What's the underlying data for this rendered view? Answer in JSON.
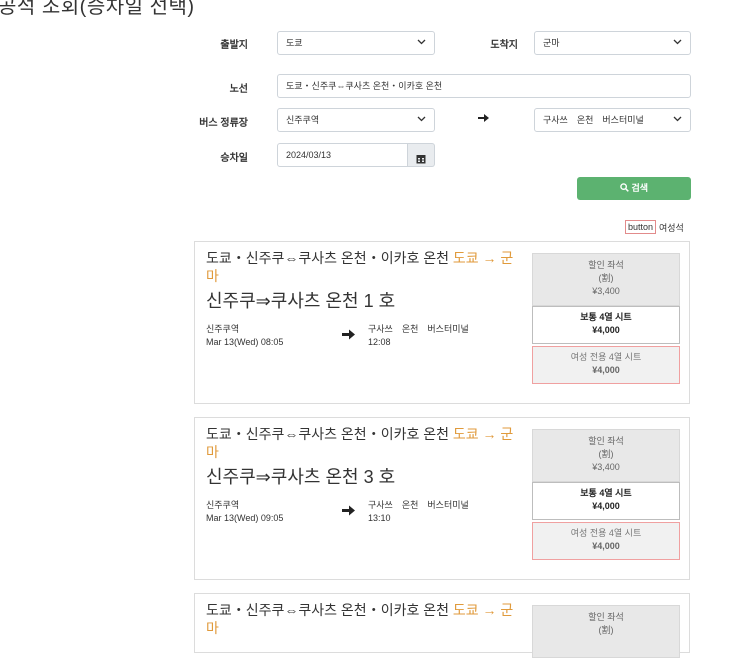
{
  "page_title": "공석 조회(승차일 선택)",
  "form": {
    "departure_label": "출발지",
    "departure_value": "도쿄",
    "arrival_label": "도착지",
    "arrival_value": "군마",
    "route_label": "노선",
    "route_value": "도쿄・신주쿠⇔쿠사츠 온천・이카호 온천",
    "stop_label": "버스 정류장",
    "stop_from": "신주쿠역",
    "stop_to": "구사쓰　온천　버스터미널",
    "date_label": "승차일",
    "date_value": "2024/03/13",
    "search_label": "검색"
  },
  "filter": {
    "button_chip": "button",
    "ladies_label": "여성석"
  },
  "results": [
    {
      "route": "도쿄・신주쿠⇔쿠사츠 온천・이카호 온천",
      "direction": "도쿄 → 군마",
      "bus": "신주쿠⇒쿠사츠 온천 1 호",
      "from_stop": "신주쿠역",
      "from_time": "Mar 13(Wed) 08:05",
      "to_stop": "구사쓰　온천　버스터미널",
      "to_time": "12:08",
      "discount_title": "할인 좌석",
      "discount_note": "(割)",
      "discount_price": "¥3,400",
      "standard_title": "보통 4열 시트",
      "standard_price": "¥4,000",
      "ladies_title": "여성 전용 4열 시트",
      "ladies_price": "¥4,000"
    },
    {
      "route": "도쿄・신주쿠⇔쿠사츠 온천・이카호 온천",
      "direction": "도쿄 → 군마",
      "bus": "신주쿠⇒쿠사츠 온천 3 호",
      "from_stop": "신주쿠역",
      "from_time": "Mar 13(Wed) 09:05",
      "to_stop": "구사쓰　온천　버스터미널",
      "to_time": "13:10",
      "discount_title": "할인 좌석",
      "discount_note": "(割)",
      "discount_price": "¥3,400",
      "standard_title": "보통 4열 시트",
      "standard_price": "¥4,000",
      "ladies_title": "여성 전용 4열 시트",
      "ladies_price": "¥4,000"
    },
    {
      "route": "도쿄・신주쿠⇔쿠사츠 온천・이카호 온천",
      "direction": "도쿄 → 군마",
      "discount_title": "할인 좌석",
      "discount_note": "(割)"
    }
  ]
}
